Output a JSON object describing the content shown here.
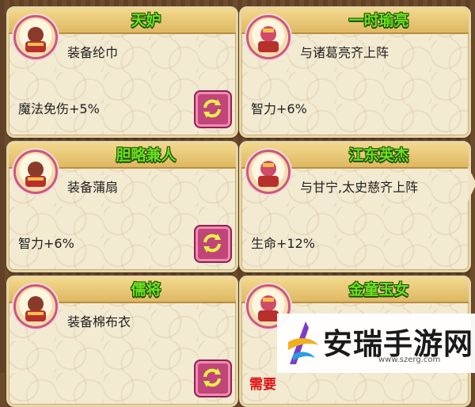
{
  "cards": [
    {
      "title": "天妒",
      "desc": "装备纶巾",
      "bonus": "魔法免伤+5%",
      "refresh": true
    },
    {
      "title": "一时瑜亮",
      "desc": "与诸葛亮齐上阵",
      "bonus": "智力+6%",
      "refresh": false
    },
    {
      "title": "胆略兼人",
      "desc": "装备蒲扇",
      "bonus": "智力+6%",
      "refresh": true
    },
    {
      "title": "江东英杰",
      "desc": "与甘宁,太史慈齐上阵",
      "bonus": "生命+12%",
      "refresh": false
    },
    {
      "title": "儒将",
      "desc": "装备棉布衣",
      "bonus": "",
      "refresh": true
    },
    {
      "title": "金童玉女",
      "desc": "",
      "bonus": "",
      "refresh": false,
      "requirement": "需要"
    }
  ],
  "watermark": {
    "brand": "安瑞手游网",
    "url": "www.szerg.com"
  },
  "colors": {
    "title_green": "#6be021",
    "card_bg": "#f3ead2",
    "refresh_pink": "#c04579"
  }
}
